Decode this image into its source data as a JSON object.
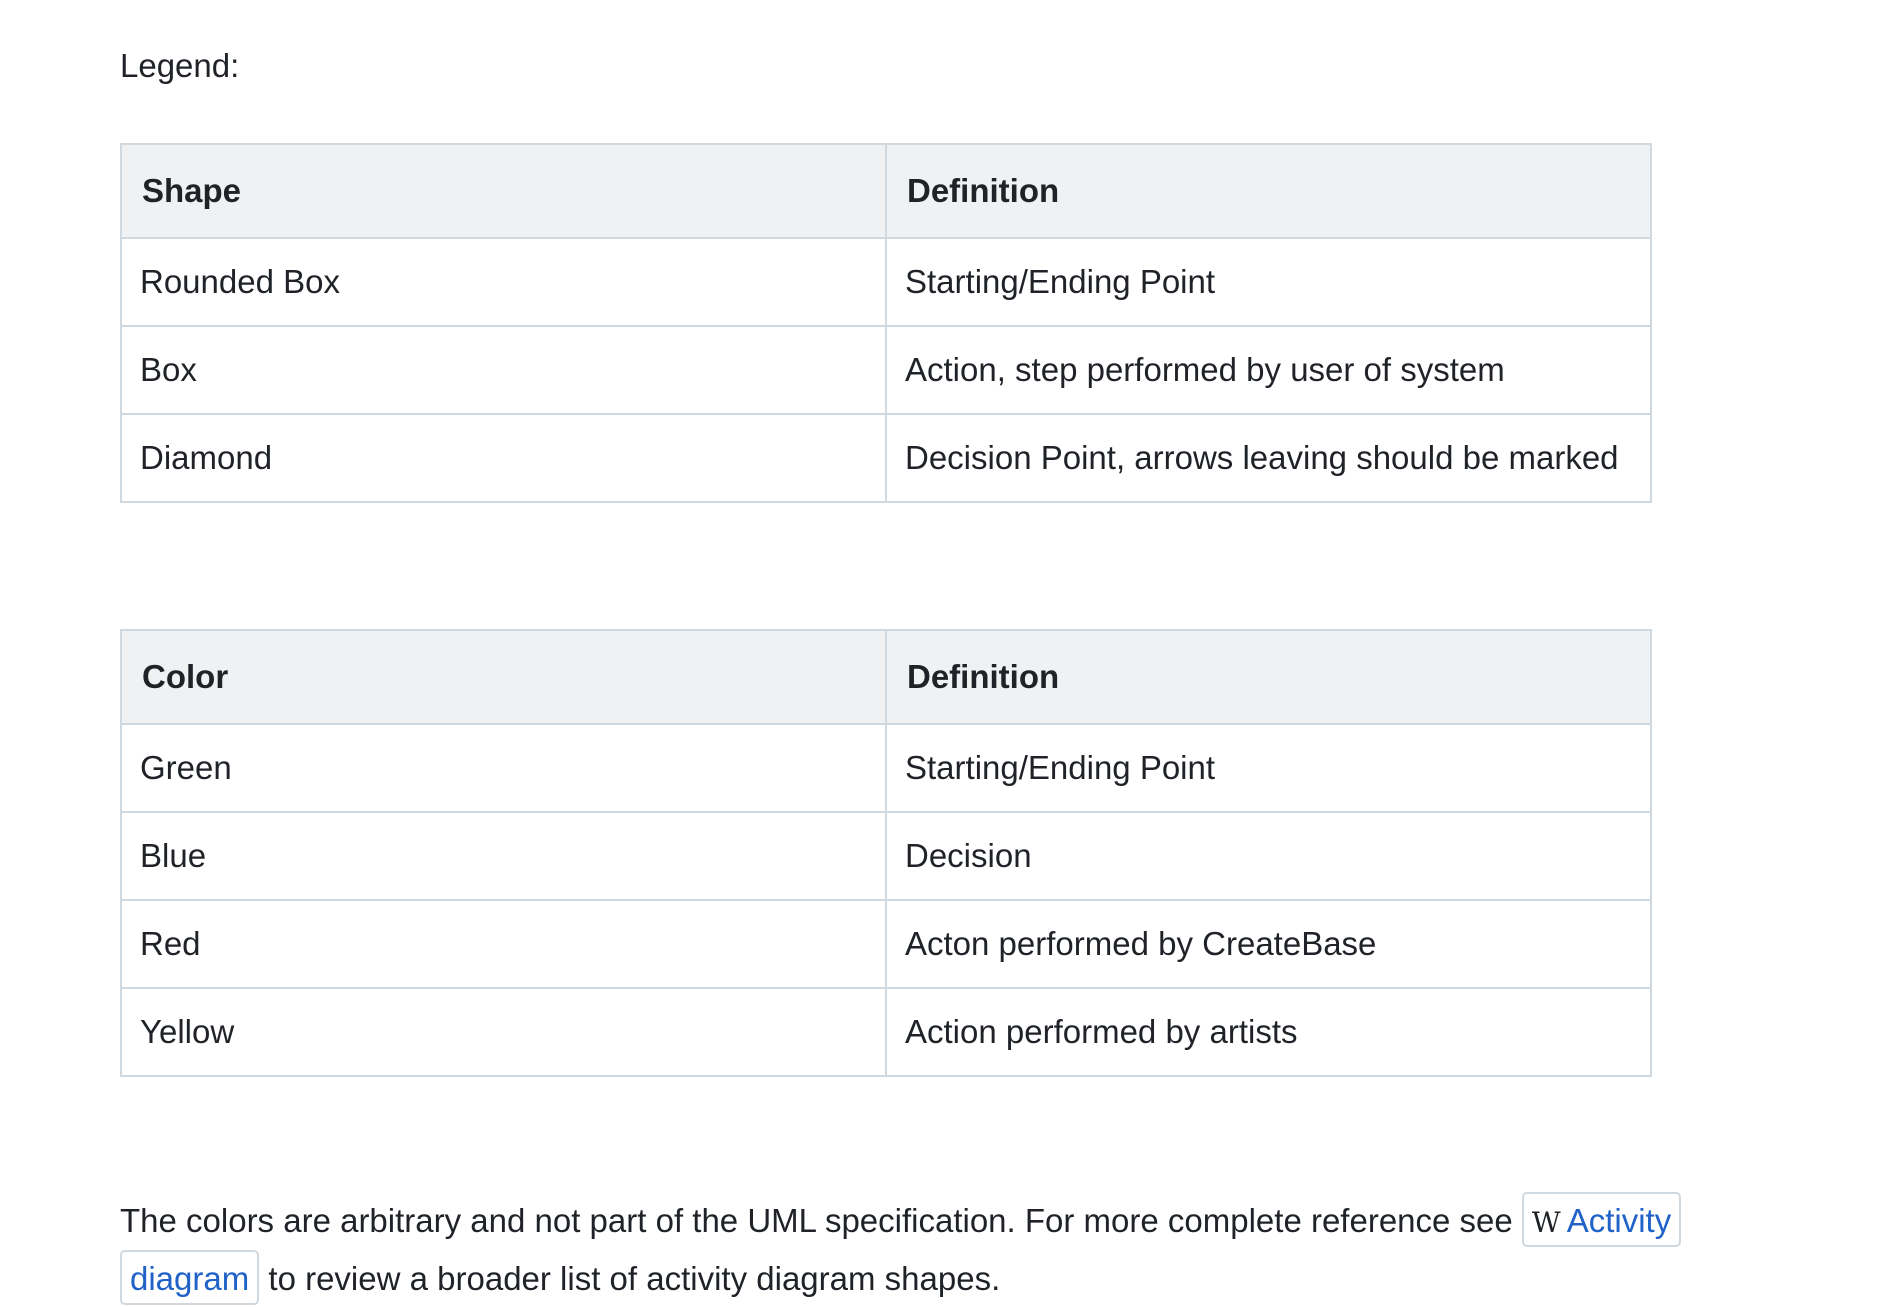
{
  "legend_label": "Legend:",
  "shape_table": {
    "headers": [
      "Shape",
      "Definition"
    ],
    "rows": [
      [
        "Rounded Box",
        "Starting/Ending Point"
      ],
      [
        "Box",
        "Action, step performed by user of system"
      ],
      [
        "Diamond",
        "Decision Point, arrows leaving should be marked"
      ]
    ]
  },
  "color_table": {
    "headers": [
      "Color",
      "Definition"
    ],
    "rows": [
      [
        "Green",
        "Starting/Ending Point"
      ],
      [
        "Blue",
        "Decision"
      ],
      [
        "Red",
        "Acton performed by CreateBase"
      ],
      [
        "Yellow",
        "Action performed by artists"
      ]
    ]
  },
  "note": {
    "text_before": "The colors are arbitrary and not part of the UML specification.  For more complete reference see ",
    "link_icon": "W",
    "link_icon_name": "wikipedia-icon",
    "link_text": "Activity diagram",
    "text_after": " to review a broader list of activity diagram shapes."
  },
  "colors": {
    "header_bg": "#f0f1f3",
    "border": "#d1d9e0",
    "link": "#2062c8",
    "text": "#1f2328"
  }
}
